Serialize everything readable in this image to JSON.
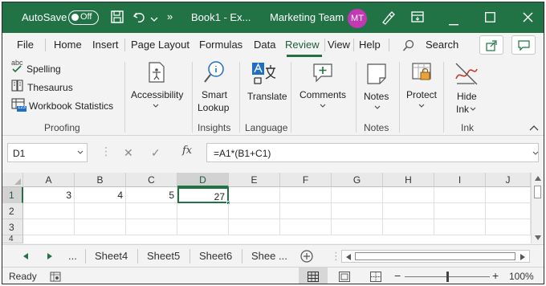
{
  "titlebar": {
    "autosave_label": "AutoSave",
    "autosave_state": "Off",
    "filename": "Book1 - Ex...",
    "team": "Marketing Team",
    "avatar_initials": "MT",
    "overflow": "»",
    "accent": "#217346"
  },
  "tabs": [
    "File",
    "Home",
    "Insert",
    "Page Layout",
    "Formulas",
    "Data",
    "Review",
    "View",
    "Help"
  ],
  "active_tab": "Review",
  "search_label": "Search",
  "ribbon": {
    "spelling_small": "abc",
    "spelling": "Spelling",
    "thesaurus": "Thesaurus",
    "workbook_statistics": "Workbook Statistics",
    "workbook_statistics_small": "123",
    "group_proofing": "Proofing",
    "accessibility": "Accessibility",
    "smart_lookup_1": "Smart",
    "smart_lookup_2": "Lookup",
    "group_insights": "Insights",
    "translate": "Translate",
    "group_language": "Language",
    "comments": "Comments",
    "notes": "Notes",
    "group_notes": "Notes",
    "protect": "Protect",
    "hide_ink_1": "Hide",
    "hide_ink_2": "Ink",
    "group_ink": "Ink"
  },
  "formula_bar": {
    "name_box": "D1",
    "fx": "fx",
    "formula": "=A1*(B1+C1)"
  },
  "grid": {
    "columns": [
      "A",
      "B",
      "C",
      "D",
      "E",
      "F",
      "G",
      "H",
      "I",
      "J"
    ],
    "rows": [
      "1",
      "2",
      "3",
      "4"
    ],
    "cells": {
      "A1": "3",
      "B1": "4",
      "C1": "5",
      "D1": "27"
    },
    "selected_cell": "D1"
  },
  "sheets": {
    "ellipsis": "...",
    "tabs": [
      "Sheet4",
      "Sheet5",
      "Sheet6",
      "Shee"
    ],
    "more": "..."
  },
  "status": {
    "ready": "Ready",
    "zoom": "100%",
    "zoom_minus": "−",
    "zoom_plus": "+"
  }
}
